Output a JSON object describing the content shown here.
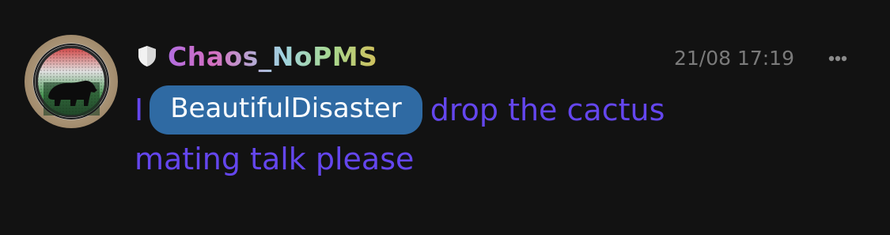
{
  "message": {
    "username": "Chaos_NoPMS",
    "timestamp": "21/08 17:19",
    "text_prefix": "I",
    "mention": "BeautifulDisaster",
    "text_line1_suffix": "drop the cactus",
    "text_line2": "mating talk please"
  },
  "icons": {
    "role": "shield-icon",
    "menu": "more-options-icon",
    "avatar": "bear-avatar"
  },
  "colors": {
    "background": "#121212",
    "message_text": "#6446ee",
    "mention_bg": "#2f6aa3",
    "mention_text": "#ffffff",
    "timestamp": "#7a7a7a"
  }
}
